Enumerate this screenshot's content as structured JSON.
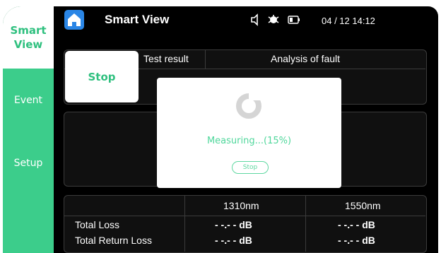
{
  "header": {
    "title": "Smart View",
    "datetime": "04 / 12  14:12"
  },
  "sidebar": {
    "items": [
      {
        "label": "Smart\nView"
      },
      {
        "label": "Event"
      },
      {
        "label": "Setup"
      }
    ]
  },
  "results": {
    "col1": "Test result",
    "col2": "Analysis of fault",
    "stop_label": "Stop"
  },
  "modal": {
    "progress_text": "Measuring...(15%)",
    "stop_label": "Stop"
  },
  "table": {
    "headers": [
      "1310nm",
      "1550nm"
    ],
    "rows": [
      {
        "label": "Total Loss",
        "v1310": "- -.- -",
        "unit1": "dB",
        "v1550": "- -.- -",
        "unit2": "dB"
      },
      {
        "label": "Total Return Loss",
        "v1310": "- -.- -",
        "unit1": "dB",
        "v1550": "- -.- -",
        "unit2": "dB"
      }
    ]
  },
  "colors": {
    "accent": "#3ccd8b",
    "brand": "#2a86e6"
  }
}
